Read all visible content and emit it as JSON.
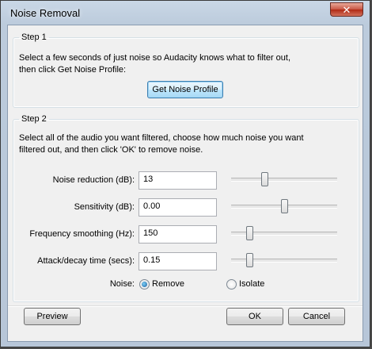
{
  "window": {
    "title": "Noise Removal",
    "close_glyph": "✕"
  },
  "step1": {
    "legend": "Step 1",
    "description_line1": "Select a few seconds of just noise so Audacity knows what to filter out,",
    "description_line2": "then click Get Noise Profile:",
    "button_label": "Get Noise Profile"
  },
  "step2": {
    "legend": "Step 2",
    "description_line1": "Select all of the audio you want filtered, choose how much noise you want",
    "description_line2": "filtered out, and then click 'OK' to remove noise.",
    "params": [
      {
        "label": "Noise reduction (dB):",
        "value": "13",
        "slider_fraction": 0.3
      },
      {
        "label": "Sensitivity (dB):",
        "value": "0.00",
        "slider_fraction": 0.5
      },
      {
        "label": "Frequency smoothing (Hz):",
        "value": "150",
        "slider_fraction": 0.15
      },
      {
        "label": "Attack/decay time (secs):",
        "value": "0.15",
        "slider_fraction": 0.15
      }
    ],
    "noise_label": "Noise:",
    "noise_options": [
      {
        "label": "Remove",
        "checked": true
      },
      {
        "label": "Isolate",
        "checked": false
      }
    ]
  },
  "footer": {
    "preview_label": "Preview",
    "ok_label": "OK",
    "cancel_label": "Cancel"
  }
}
